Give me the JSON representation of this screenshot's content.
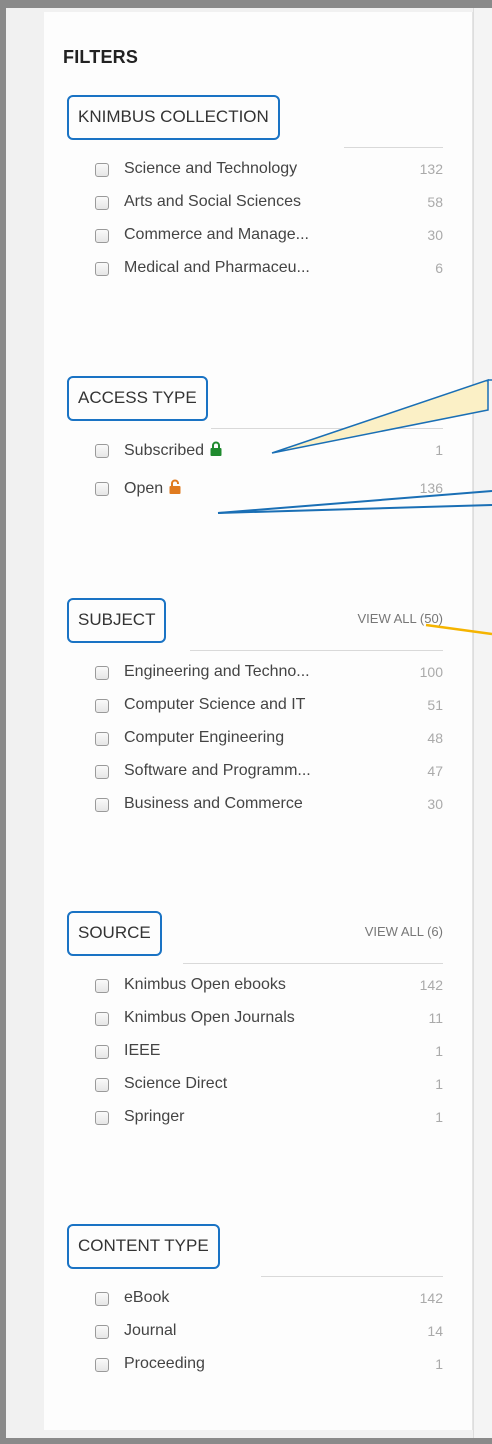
{
  "panel": {
    "title": "FILTERS"
  },
  "sections": [
    {
      "title": "KNIMBUS COLLECTION",
      "view_all": "",
      "items": [
        {
          "label": "Science and Technology",
          "count": "132"
        },
        {
          "label": "Arts and Social Sciences",
          "count": "58"
        },
        {
          "label": "Commerce and Manage...",
          "count": "30"
        },
        {
          "label": "Medical and Pharmaceu...",
          "count": "6"
        }
      ]
    },
    {
      "title": "ACCESS TYPE",
      "view_all": "",
      "items": [
        {
          "label": "Subscribed",
          "count": "1",
          "icon": "lock-closed-icon"
        },
        {
          "label": "Open",
          "count": "136",
          "icon": "lock-open-icon"
        }
      ]
    },
    {
      "title": "SUBJECT",
      "view_all": "VIEW ALL (50)",
      "items": [
        {
          "label": "Engineering and Techno...",
          "count": "100"
        },
        {
          "label": "Computer Science and IT",
          "count": "51"
        },
        {
          "label": "Computer Engineering",
          "count": "48"
        },
        {
          "label": "Software and Programm...",
          "count": "47"
        },
        {
          "label": "Business and Commerce",
          "count": "30"
        }
      ]
    },
    {
      "title": "SOURCE",
      "view_all": "VIEW ALL (6)",
      "items": [
        {
          "label": "Knimbus Open ebooks",
          "count": "142"
        },
        {
          "label": "Knimbus Open Journals",
          "count": "11"
        },
        {
          "label": "IEEE",
          "count": "1"
        },
        {
          "label": "Science Direct",
          "count": "1"
        },
        {
          "label": "Springer",
          "count": "1"
        }
      ]
    },
    {
      "title": "CONTENT TYPE",
      "view_all": "",
      "items": [
        {
          "label": "eBook",
          "count": "142"
        },
        {
          "label": "Journal",
          "count": "14"
        },
        {
          "label": "Proceeding",
          "count": "1"
        }
      ]
    }
  ],
  "colors": {
    "highlight_border": "#1a73c4",
    "lock_subscribed": "#1f8a2e",
    "lock_open": "#e07b20",
    "callout_fill": "#fbf0c6",
    "callout_arrow_yellow": "#f5b400"
  }
}
